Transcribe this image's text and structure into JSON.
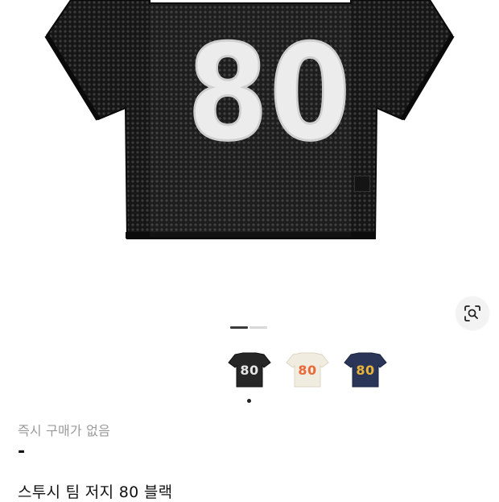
{
  "product": {
    "hero_number": "80",
    "status": "즉시 구매가 없음",
    "price": "-",
    "name": "스투시 팀 저지 80 블랙"
  },
  "carousel": {
    "total_slides": 2,
    "active_slide": 1
  },
  "variants": [
    {
      "number": "80",
      "jersey_color": "#2a2a2a",
      "number_color": "#e9e9e9"
    },
    {
      "number": "80",
      "jersey_color": "#f1ece0",
      "number_color": "#e8693a"
    },
    {
      "number": "80",
      "jersey_color": "#2a3558",
      "number_color": "#e8b53a"
    }
  ],
  "colors": {
    "jersey_black": "#1c1c1c",
    "number_white": "#eeeeee",
    "indicator_active": "#3a3a3a",
    "indicator_inactive": "#d8d8d8",
    "muted_text": "#9a9a9a"
  },
  "icons": {
    "visual_search": "lens-search-icon"
  }
}
